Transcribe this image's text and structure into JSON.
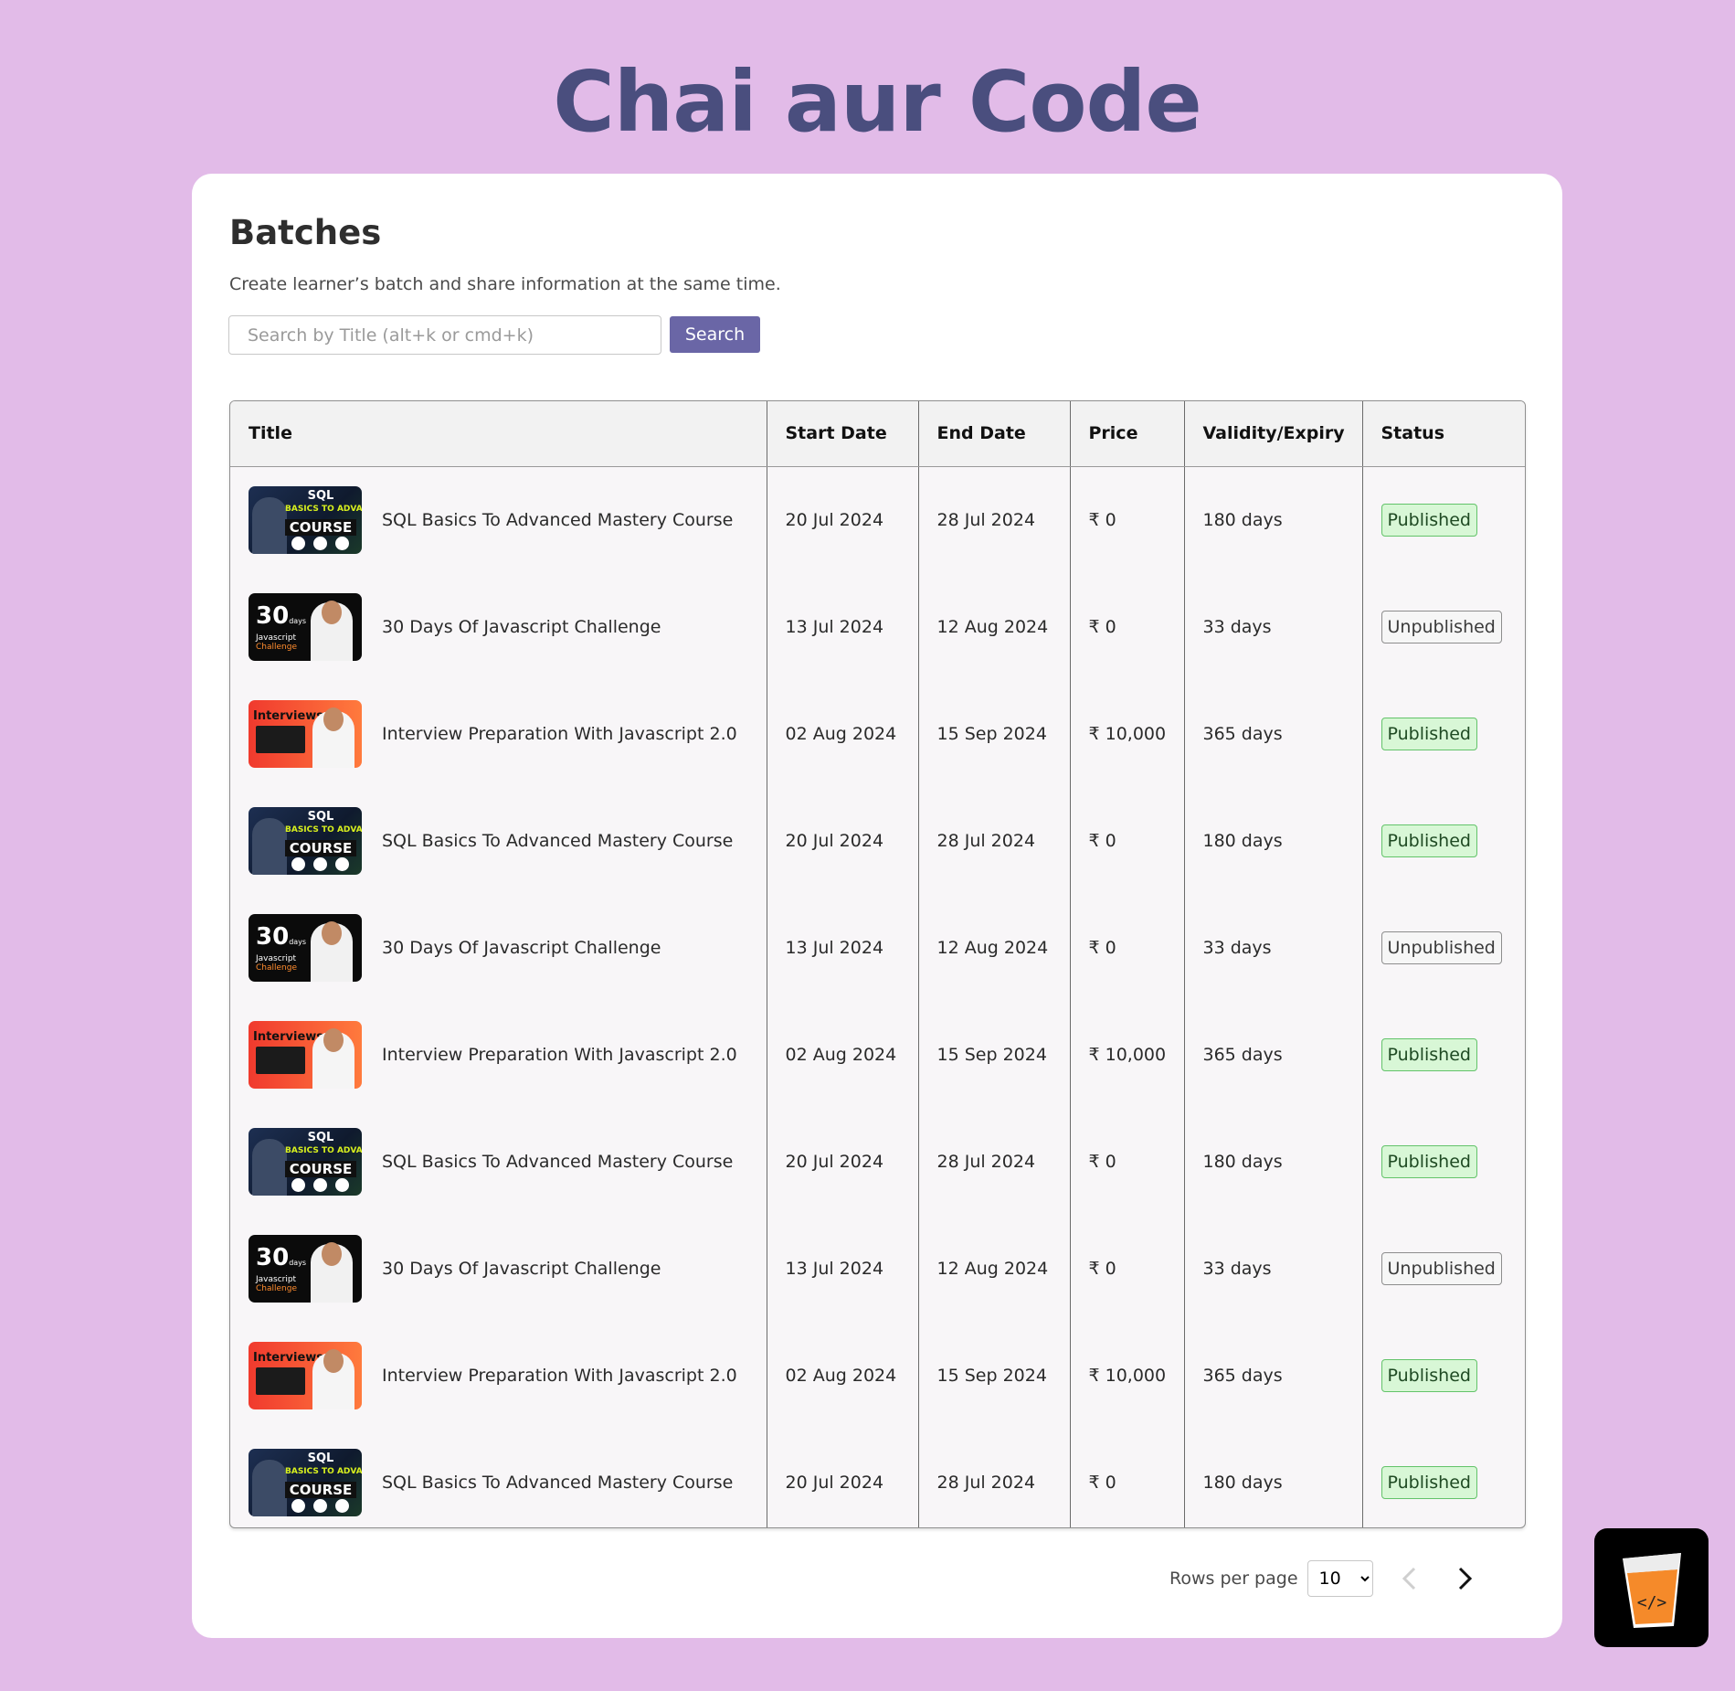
{
  "app": {
    "title": "Chai aur Code"
  },
  "card": {
    "title": "Batches",
    "subtitle": "Create learner’s batch and share information at the same time."
  },
  "search": {
    "placeholder": "Search by Title (alt+k or cmd+k)",
    "button_label": "Search"
  },
  "table": {
    "columns": [
      "Title",
      "Start Date",
      "End Date",
      "Price",
      "Validity/Expiry",
      "Status"
    ],
    "rows": [
      {
        "thumb": "sql",
        "title": "SQL Basics To Advanced Mastery Course",
        "start": "20 Jul 2024",
        "end": "28 Jul 2024",
        "price": "₹ 0",
        "validity": "180 days",
        "status": "Published"
      },
      {
        "thumb": "js",
        "title": "30 Days Of Javascript Challenge",
        "start": "13 Jul 2024",
        "end": "12 Aug 2024",
        "price": "₹ 0",
        "validity": "33 days",
        "status": "Unpublished"
      },
      {
        "thumb": "int",
        "title": "Interview Preparation With Javascript 2.0",
        "start": "02 Aug 2024",
        "end": "15 Sep 2024",
        "price": "₹ 10,000",
        "validity": "365 days",
        "status": "Published"
      },
      {
        "thumb": "sql",
        "title": "SQL Basics To Advanced Mastery Course",
        "start": "20 Jul 2024",
        "end": "28 Jul 2024",
        "price": "₹ 0",
        "validity": "180 days",
        "status": "Published"
      },
      {
        "thumb": "js",
        "title": "30 Days Of Javascript Challenge",
        "start": "13 Jul 2024",
        "end": "12 Aug 2024",
        "price": "₹ 0",
        "validity": "33 days",
        "status": "Unpublished"
      },
      {
        "thumb": "int",
        "title": "Interview Preparation With Javascript 2.0",
        "start": "02 Aug 2024",
        "end": "15 Sep 2024",
        "price": "₹ 10,000",
        "validity": "365 days",
        "status": "Published"
      },
      {
        "thumb": "sql",
        "title": "SQL Basics To Advanced Mastery Course",
        "start": "20 Jul 2024",
        "end": "28 Jul 2024",
        "price": "₹ 0",
        "validity": "180 days",
        "status": "Published"
      },
      {
        "thumb": "js",
        "title": "30 Days Of Javascript Challenge",
        "start": "13 Jul 2024",
        "end": "12 Aug 2024",
        "price": "₹ 0",
        "validity": "33 days",
        "status": "Unpublished"
      },
      {
        "thumb": "int",
        "title": "Interview Preparation With Javascript 2.0",
        "start": "02 Aug 2024",
        "end": "15 Sep 2024",
        "price": "₹ 10,000",
        "validity": "365 days",
        "status": "Published"
      },
      {
        "thumb": "sql",
        "title": "SQL Basics To Advanced Mastery Course",
        "start": "20 Jul 2024",
        "end": "28 Jul 2024",
        "price": "₹ 0",
        "validity": "180 days",
        "status": "Published"
      }
    ]
  },
  "thumbnails": {
    "sql": {
      "line1": "SQL",
      "line2": "BASICS TO ADVANCED",
      "line3": "COURSE"
    },
    "js": {
      "line1": "30",
      "line2": "days",
      "line3": "Javascript",
      "line4": "Challenge"
    },
    "int": {
      "line1": "Interviews"
    }
  },
  "pagination": {
    "rows_label": "Rows per page",
    "rows_value": "10",
    "rows_options": [
      "10"
    ],
    "prev_icon": "chevron-left-icon",
    "next_icon": "chevron-right-icon"
  },
  "fab": {
    "icon": "chai-cup-code-icon"
  },
  "colors": {
    "background": "#e2bbe8",
    "title": "#4a4e7e",
    "accent": "#6a66a6",
    "published_bg": "#d8f7d6",
    "published_border": "#63c36a"
  }
}
